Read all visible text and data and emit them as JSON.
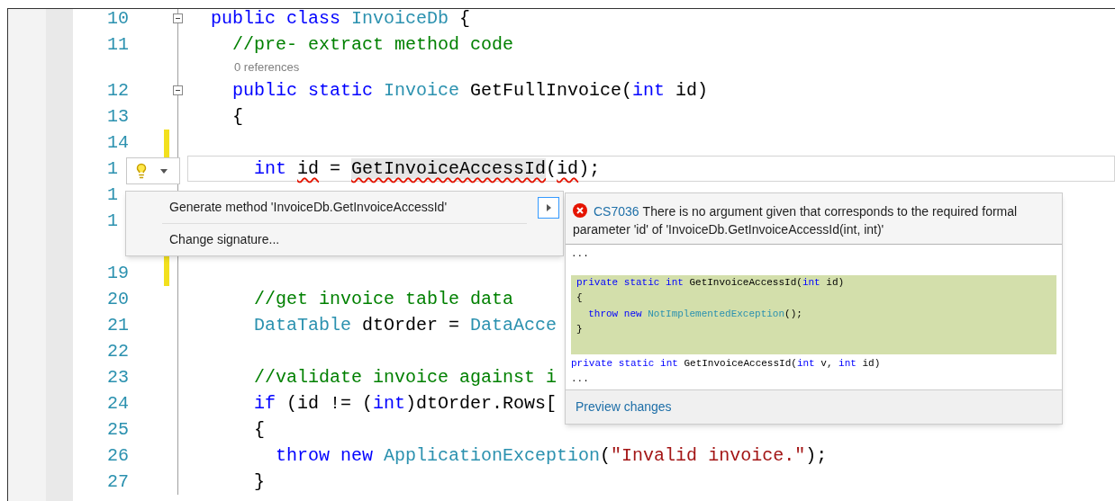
{
  "editor": {
    "lines": [
      {
        "kind": "code",
        "number": "10",
        "collapsible": true,
        "changed": false,
        "current": false,
        "tokens": [
          {
            "text": "public",
            "kind": "keyword"
          },
          {
            "text": " class",
            "kind": "keyword"
          },
          {
            "text": " InvoiceDb",
            "kind": "type"
          },
          {
            "text": " {"
          }
        ]
      },
      {
        "kind": "code",
        "number": "11",
        "collapsible": false,
        "changed": false,
        "current": false,
        "tokens": [
          {
            "text": "  //pre- extract method code",
            "kind": "comment"
          }
        ]
      },
      {
        "kind": "codelens",
        "text": "0 references"
      },
      {
        "kind": "code",
        "number": "12",
        "collapsible": true,
        "changed": false,
        "current": false,
        "tokens": [
          {
            "text": "  public",
            "kind": "keyword"
          },
          {
            "text": " static",
            "kind": "keyword"
          },
          {
            "text": " Invoice",
            "kind": "type"
          },
          {
            "text": " GetFullInvoice("
          },
          {
            "text": "int",
            "kind": "keyword"
          },
          {
            "text": " id)"
          }
        ]
      },
      {
        "kind": "code",
        "number": "13",
        "collapsible": false,
        "changed": false,
        "current": false,
        "tokens": [
          {
            "text": "  {"
          }
        ]
      },
      {
        "kind": "code",
        "number": "14",
        "collapsible": false,
        "changed": true,
        "current": false
      },
      {
        "kind": "code",
        "number": "1",
        "collapsible": false,
        "changed": true,
        "current": true,
        "tokens": [
          {
            "text": "    int ",
            "kind": "keyword"
          },
          {
            "text": "id",
            "error": true
          },
          {
            "text": " = "
          },
          {
            "text": "GetInvoiceAccessId",
            "error": true,
            "highlighted": true
          },
          {
            "text": "("
          },
          {
            "text": "id",
            "error": true
          },
          {
            "text": ");"
          }
        ]
      },
      {
        "kind": "code",
        "number": "1",
        "collapsible": false,
        "changed": false,
        "current": false
      },
      {
        "kind": "code",
        "number": "1",
        "collapsible": false,
        "changed": false,
        "current": false
      },
      {
        "kind": "code",
        "collapsible": false,
        "changed": true,
        "current": false
      },
      {
        "kind": "code",
        "number": "19",
        "collapsible": false,
        "changed": true,
        "current": false
      },
      {
        "kind": "code",
        "number": "20",
        "collapsible": false,
        "changed": false,
        "current": false,
        "tokens": [
          {
            "text": "    //get invoice table data",
            "kind": "comment"
          }
        ]
      },
      {
        "kind": "code",
        "number": "21",
        "collapsible": false,
        "changed": false,
        "current": false,
        "tokens": [
          {
            "text": "    DataTable",
            "kind": "type"
          },
          {
            "text": " dtOrder = "
          },
          {
            "text": "DataAcce",
            "kind": "type"
          }
        ]
      },
      {
        "kind": "code",
        "number": "22",
        "collapsible": false,
        "changed": false,
        "current": false
      },
      {
        "kind": "code",
        "number": "23",
        "collapsible": false,
        "changed": false,
        "current": false,
        "tokens": [
          {
            "text": "    //validate invoice against i",
            "kind": "comment"
          }
        ]
      },
      {
        "kind": "code",
        "number": "24",
        "collapsible": false,
        "changed": false,
        "current": false,
        "tokens": [
          {
            "text": "    if",
            "kind": "keyword"
          },
          {
            "text": " (id != ("
          },
          {
            "text": "int",
            "kind": "keyword"
          },
          {
            "text": ")dtOrder.Rows["
          }
        ]
      },
      {
        "kind": "code",
        "number": "25",
        "collapsible": false,
        "changed": false,
        "current": false,
        "tokens": [
          {
            "text": "    {"
          }
        ]
      },
      {
        "kind": "code",
        "number": "26",
        "collapsible": false,
        "changed": false,
        "current": false,
        "tokens": [
          {
            "text": "      throw",
            "kind": "keyword"
          },
          {
            "text": " new",
            "kind": "keyword"
          },
          {
            "text": " ApplicationException",
            "kind": "type"
          },
          {
            "text": "("
          },
          {
            "text": "\"Invalid invoice.\"",
            "kind": "string"
          },
          {
            "text": ");"
          }
        ]
      },
      {
        "kind": "code",
        "number": "27",
        "collapsible": false,
        "changed": false,
        "current": false,
        "tokens": [
          {
            "text": "    }"
          }
        ]
      }
    ]
  },
  "quick_actions": {
    "items": [
      {
        "label": "Generate method 'InvoiceDb.GetInvoiceAccessId'",
        "submenu": true
      },
      {
        "label": "Change signature...",
        "submenu": false
      }
    ]
  },
  "preview": {
    "error_code": "CS7036",
    "message": "There is no argument given that corresponds to the required formal parameter 'id' of 'InvoiceDb.GetInvoiceAccessId(int, int)'",
    "diff": [
      {
        "kind": "context",
        "lines": [
          [
            {
              "text": "..."
            }
          ]
        ]
      },
      {
        "kind": "added",
        "lines": [
          [
            {
              "text": "private",
              "kind": "keyword"
            },
            {
              "text": " static",
              "kind": "keyword"
            },
            {
              "text": " int",
              "kind": "keyword"
            },
            {
              "text": " GetInvoiceAccessId("
            },
            {
              "text": "int",
              "kind": "keyword"
            },
            {
              "text": " id)"
            }
          ],
          [
            {
              "text": "{"
            }
          ],
          [
            {
              "text": "  throw",
              "kind": "keyword"
            },
            {
              "text": " new",
              "kind": "keyword"
            },
            {
              "text": " NotImplementedException",
              "kind": "type"
            },
            {
              "text": "();"
            }
          ],
          [
            {
              "text": "}"
            }
          ]
        ]
      },
      {
        "kind": "context",
        "lines": [
          [
            {
              "text": "private",
              "kind": "keyword"
            },
            {
              "text": " static",
              "kind": "keyword"
            },
            {
              "text": " int",
              "kind": "keyword"
            },
            {
              "text": " GetInvoiceAccessId("
            },
            {
              "text": "int",
              "kind": "keyword"
            },
            {
              "text": " v, "
            },
            {
              "text": "int",
              "kind": "keyword"
            },
            {
              "text": " id)"
            }
          ],
          [
            {
              "text": "..."
            }
          ]
        ]
      }
    ],
    "link": "Preview changes"
  }
}
